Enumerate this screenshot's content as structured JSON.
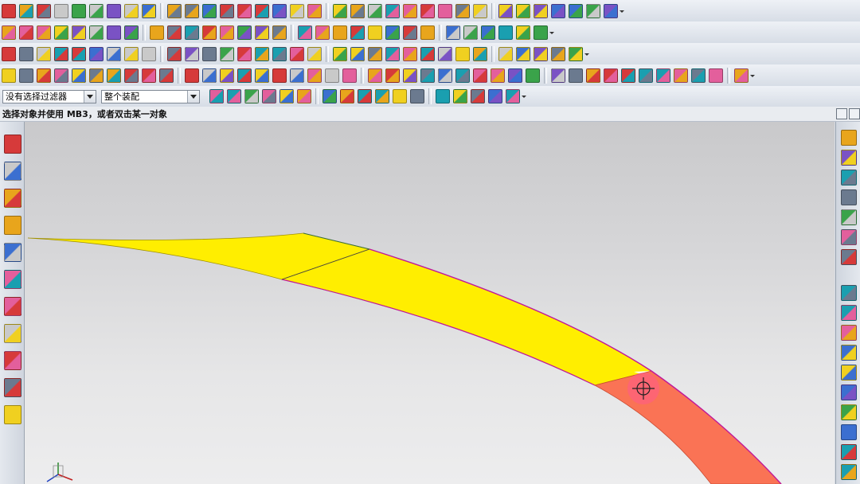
{
  "filter_bar": {
    "selection_filter": "没有选择过滤器",
    "assembly_scope": "整个装配"
  },
  "status_line": {
    "prompt": "选择对象并使用 MB3，或者双击某一对象"
  },
  "colors": {
    "surface_yellow": "#ffee00",
    "surface_highlight": "#fa7355",
    "edge_magenta": "#c0189a",
    "cursor_halo": "#ff5a8c"
  },
  "toolbar_icons": {
    "row1": [
      "new-file-icon",
      "block-icon",
      "cylinder-feature-icon",
      "cylinder-icon",
      "box-icon",
      "sphere-icon",
      "pad-icon",
      "boss-icon",
      "extrude-icon",
      "revolve-icon",
      "hole-icon",
      "slot-icon",
      "groove-icon",
      "sweep-icon",
      "tube-icon",
      "edge-blend-icon",
      "chamfer-icon",
      "shell-icon",
      "draft-icon",
      "thicken-icon",
      "offset-face-icon",
      "trim-body-icon",
      "split-body-icon",
      "unite-icon",
      "subtract-icon",
      "intersect-icon",
      "pattern-icon",
      "mirror-icon",
      "blend-icon",
      "face-blend-icon",
      "swept-icon",
      "studio-surface-icon",
      "curve-icon",
      "spline-icon"
    ],
    "row2": [
      "sketch-icon",
      "datum-plane-icon",
      "datum-axis-icon",
      "datum-csys-icon",
      "point-icon",
      "measure-distance-icon",
      "measure-angle-icon",
      "section-view-icon",
      "analysis-icon",
      "layer-icon",
      "move-layer-icon",
      "m-macro-icon",
      "calculator-icon",
      "grid-icon",
      "table-icon",
      "view-cube-icon",
      "snap-icon",
      "clock-icon",
      "triangle-icon",
      "hourglass-icon",
      "fit-icon",
      "zoom-icon",
      "rotate-icon",
      "pan-icon",
      "view-orient-icon",
      "shaded-icon",
      "wireframe-icon",
      "sphere-render-icon",
      "sheet-icon",
      "material-icon"
    ],
    "row3": [
      "selection-red-cube-icon",
      "green-diamond-icon",
      "wire-cube-icon",
      "bracket-icon",
      "book-icon",
      "color-grid-icon",
      "cross-icon",
      "line-icon",
      "circle-target-icon",
      "hatch-icon",
      "rectangle-icon",
      "arc-icon",
      "angle-icon",
      "shape-icon",
      "delete-icon",
      "x-red-icon",
      "folder-icon",
      "user-icon",
      "paint-icon",
      "fill-icon",
      "face-icon",
      "curve-red-icon",
      "spline-red-icon",
      "refresh-icon",
      "manager-icon",
      "assembly-icon",
      "constraint-icon",
      "mate-icon",
      "explode-icon",
      "snap-point-icon",
      "undo-icon",
      "search-icon"
    ],
    "row4": [
      "face-analysis-icon",
      "gem-icon",
      "cone-icon",
      "color-bar-icon",
      "cube-gray-icon",
      "line-diag-icon",
      "flag-green-icon",
      "box-outline-icon",
      "dark-panel-icon",
      "brush-icon",
      "letter-a-icon",
      "blue-wedge-icon",
      "pink-ribbon-icon",
      "red-box-icon",
      "gray-dial-icon",
      "tap-icon",
      "paper-icon",
      "knife-icon",
      "orange-square-icon",
      "net-icon",
      "m-gold-icon",
      "m-color-icon",
      "orange-cube-icon",
      "orange-ball-icon",
      "red-diamond-icon",
      "ruler-icon",
      "measure-vertical-icon",
      "slash-icon",
      "pink-sketch-icon",
      "red-ball-icon",
      "dark-ball-icon",
      "dark-red-ball-icon",
      "ring-icon",
      "shaft-icon",
      "bolt-icon",
      "screw-icon",
      "nail-icon",
      "stack-icon",
      "funnel-icon",
      "pin-icon",
      "spring-icon"
    ],
    "row5": [
      "refresh-gray-icon",
      "snap-grid-icon",
      "lasso-icon",
      "undo-gray-icon",
      "redo-gray-icon",
      "select-rect-icon",
      "end-point-icon",
      "mid-point-icon",
      "intersection-icon",
      "curve-point-icon",
      "perpendicular-icon",
      "circle-center-icon",
      "quadrant-icon",
      "plus-point-icon",
      "line-point-icon",
      "face-point-icon",
      "view-icon"
    ]
  },
  "resource_bar": [
    "assembly-navigator-icon",
    "constraint-navigator-icon",
    "part-navigator-icon",
    "reuse-library-icon",
    "web-browser-icon",
    "history-icon",
    "system-materials-icon",
    "process-studio-icon",
    "manufacturing-wizard-icon",
    "roles-icon",
    "system-scenes-icon"
  ],
  "right_bar": [
    "solid-feature-icon",
    "surface-feature-icon",
    "boolean-feature-icon",
    "wire-frame-feature-icon",
    "sheet-body-icon",
    "offset-feature-icon",
    "pattern-feature-icon",
    "screw-tool-icon",
    "bolt-tool-icon",
    "panel-tool-icon",
    "display-tool-icon",
    "note-tool-icon",
    "clamp-tool-icon",
    "sensor-tool-icon",
    "pin-tool-icon",
    "bracket-tool-icon",
    "spring-tool-icon"
  ]
}
